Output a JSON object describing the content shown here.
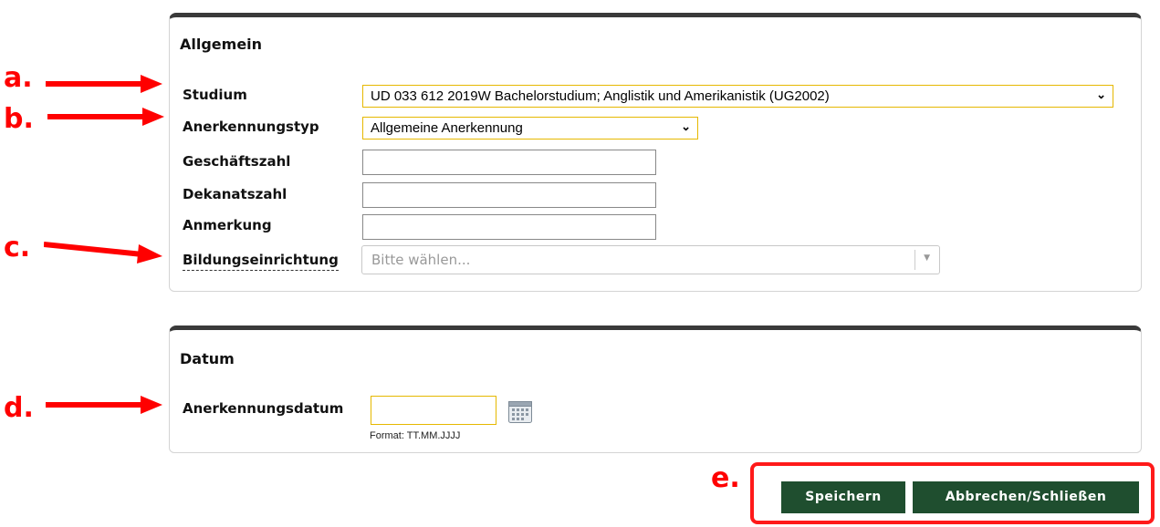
{
  "panel_general": {
    "title": "Allgemein",
    "fields": {
      "studium_label": "Studium",
      "studium_value": "UD 033 612 2019W Bachelorstudium; Anglistik und Amerikanistik (UG2002)",
      "anerkennungstyp_label": "Anerkennungstyp",
      "anerkennungstyp_value": "Allgemeine Anerkennung",
      "geschaeftszahl_label": "Geschäftszahl",
      "dekanatszahl_label": "Dekanatszahl",
      "anmerkung_label": "Anmerkung",
      "bildungseinrichtung_label": "Bildungseinrichtung",
      "bildungseinrichtung_placeholder": "Bitte wählen..."
    }
  },
  "panel_date": {
    "title": "Datum",
    "date_label": "Anerkennungsdatum",
    "format_hint": "Format: TT.MM.JJJJ"
  },
  "buttons": {
    "save": "Speichern",
    "cancel": "Abbrechen/Schließen"
  },
  "annotations": {
    "a": "a.",
    "b": "b.",
    "c": "c.",
    "d": "d.",
    "e": "e."
  },
  "colors": {
    "button_bg": "#1f4e2f",
    "highlight_border": "#e6b800",
    "annotation_red": "#ff0000"
  }
}
